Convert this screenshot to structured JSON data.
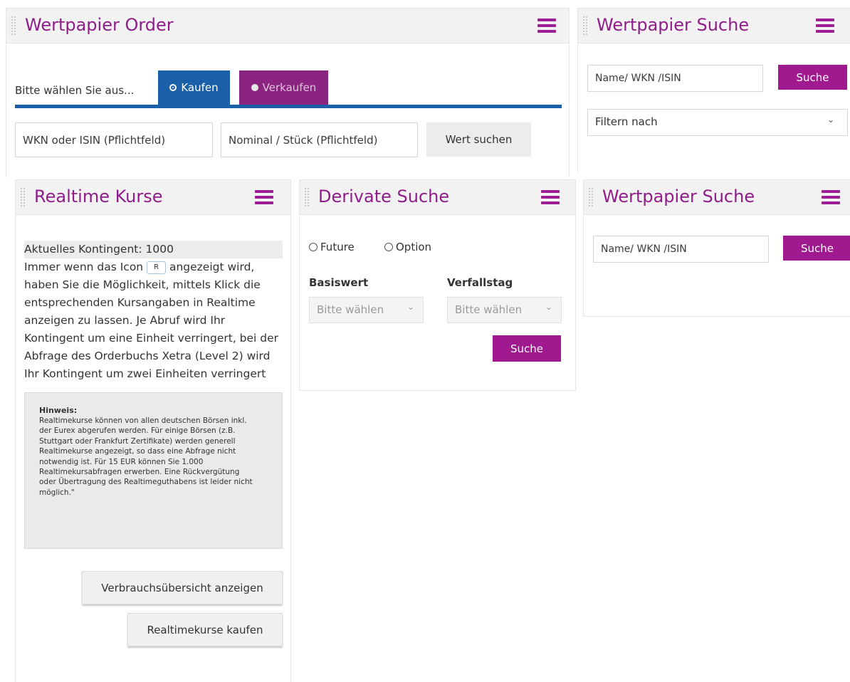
{
  "order": {
    "title": "Wertpapier Order",
    "prompt": "Bitte wählen Sie aus...",
    "buy_label": "Kaufen",
    "sell_label": "Verkaufen",
    "wkn_placeholder": "WKN oder ISIN (Pflichtfeld)",
    "nominal_placeholder": "Nominal / Stück (Pflichtfeld)",
    "search_button": "Wert suchen"
  },
  "search_top": {
    "title": "Wertpapier Suche",
    "input_placeholder": "Name/ WKN /ISIN",
    "search_button": "Suche",
    "filter_label": "Filtern nach"
  },
  "realtime": {
    "title": "Realtime Kurse",
    "contingent": "Aktuelles Kontingent: 1000",
    "info_before_icon": "Immer wenn das Icon",
    "icon_letter": "R",
    "info_after_icon": "angezeigt wird, haben Sie die Möglichkeit, mittels Klick die entsprechenden Kursangaben in Realtime anzeigen zu lassen. Je Abruf wird Ihr Kontingent um eine Einheit verringert, bei der Abfrage des Orderbuchs Xetra (Level 2) wird Ihr Kontingent um zwei Einheiten verringert",
    "note_title": "Hinweis:",
    "note_text": "Realtimekurse können von allen deutschen Börsen inkl. der Eurex abgerufen werden. Für einige Börsen (z.B. Stuttgart oder Frankfurt Zertifikate) werden generell Realtimekurse angezeigt, so dass eine Abfrage nicht notwendig ist. Für 15 EUR können Sie 1.000 Realtimekursabfragen erwerben. Eine Rückvergütung oder Übertragung des Realtimeguthabens ist leider nicht möglich.\"",
    "usage_button": "Verbrauchsübersicht anzeigen",
    "buy_button": "Realtimekurse kaufen"
  },
  "derivate": {
    "title": "Derivate Suche",
    "option_future": "Future",
    "option_option": "Option",
    "basiswert_label": "Basiswert",
    "verfallstag_label": "Verfallstag",
    "basiswert_value": "Bitte wählen",
    "verfallstag_value": "Bitte wählen",
    "search_button": "Suche"
  },
  "search_bottom": {
    "title": "Wertpapier Suche",
    "input_placeholder": "Name/ WKN /ISIN",
    "search_button": "Suche"
  },
  "colors": {
    "title": "#8f1d8a",
    "buy_tab": "#1a5fa8",
    "sell_tab": "#8b2480",
    "button": "#a0198f"
  }
}
